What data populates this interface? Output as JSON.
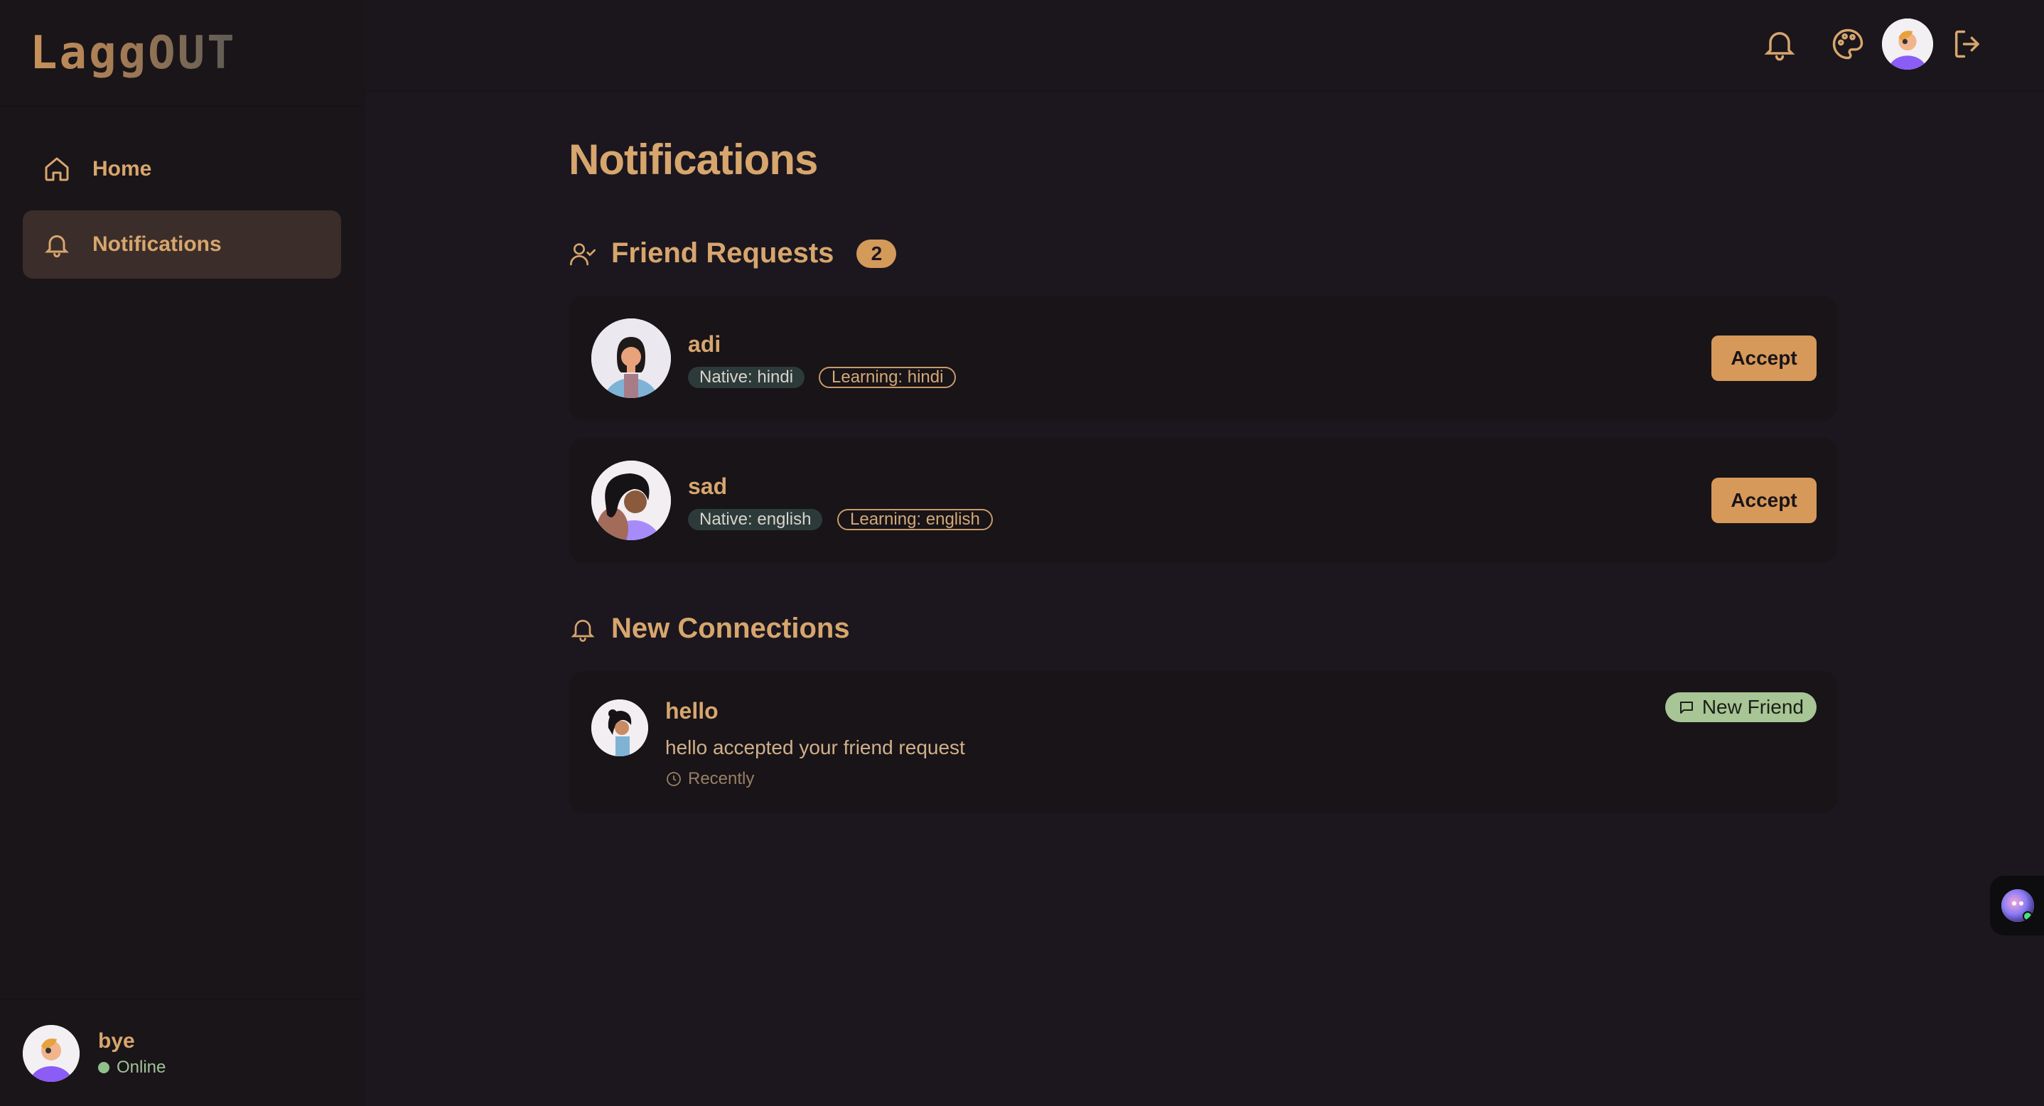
{
  "app": {
    "logo": "LaggOUT"
  },
  "sidebar": {
    "items": [
      {
        "label": "Home",
        "icon": "home-icon",
        "active": false
      },
      {
        "label": "Notifications",
        "icon": "bell-icon",
        "active": true
      }
    ],
    "user": {
      "name": "bye",
      "status": "Online"
    }
  },
  "topbar": {
    "icons": [
      "bell-icon",
      "palette-icon",
      "avatar",
      "logout-icon"
    ]
  },
  "page": {
    "title": "Notifications"
  },
  "friend_requests": {
    "title": "Friend Requests",
    "count": "2",
    "items": [
      {
        "name": "adi",
        "native": "Native: hindi",
        "learning": "Learning: hindi",
        "action": "Accept"
      },
      {
        "name": "sad",
        "native": "Native: english",
        "learning": "Learning: english",
        "action": "Accept"
      }
    ]
  },
  "connections": {
    "title": "New Connections",
    "items": [
      {
        "name": "hello",
        "message": "hello accepted your friend request",
        "time": "Recently",
        "badge": "New Friend"
      }
    ]
  },
  "colors": {
    "accent": "#d6995a",
    "background": "#1c171f",
    "text": "#d7a66d",
    "online": "#8fc18a",
    "badge": "#a7c595"
  }
}
